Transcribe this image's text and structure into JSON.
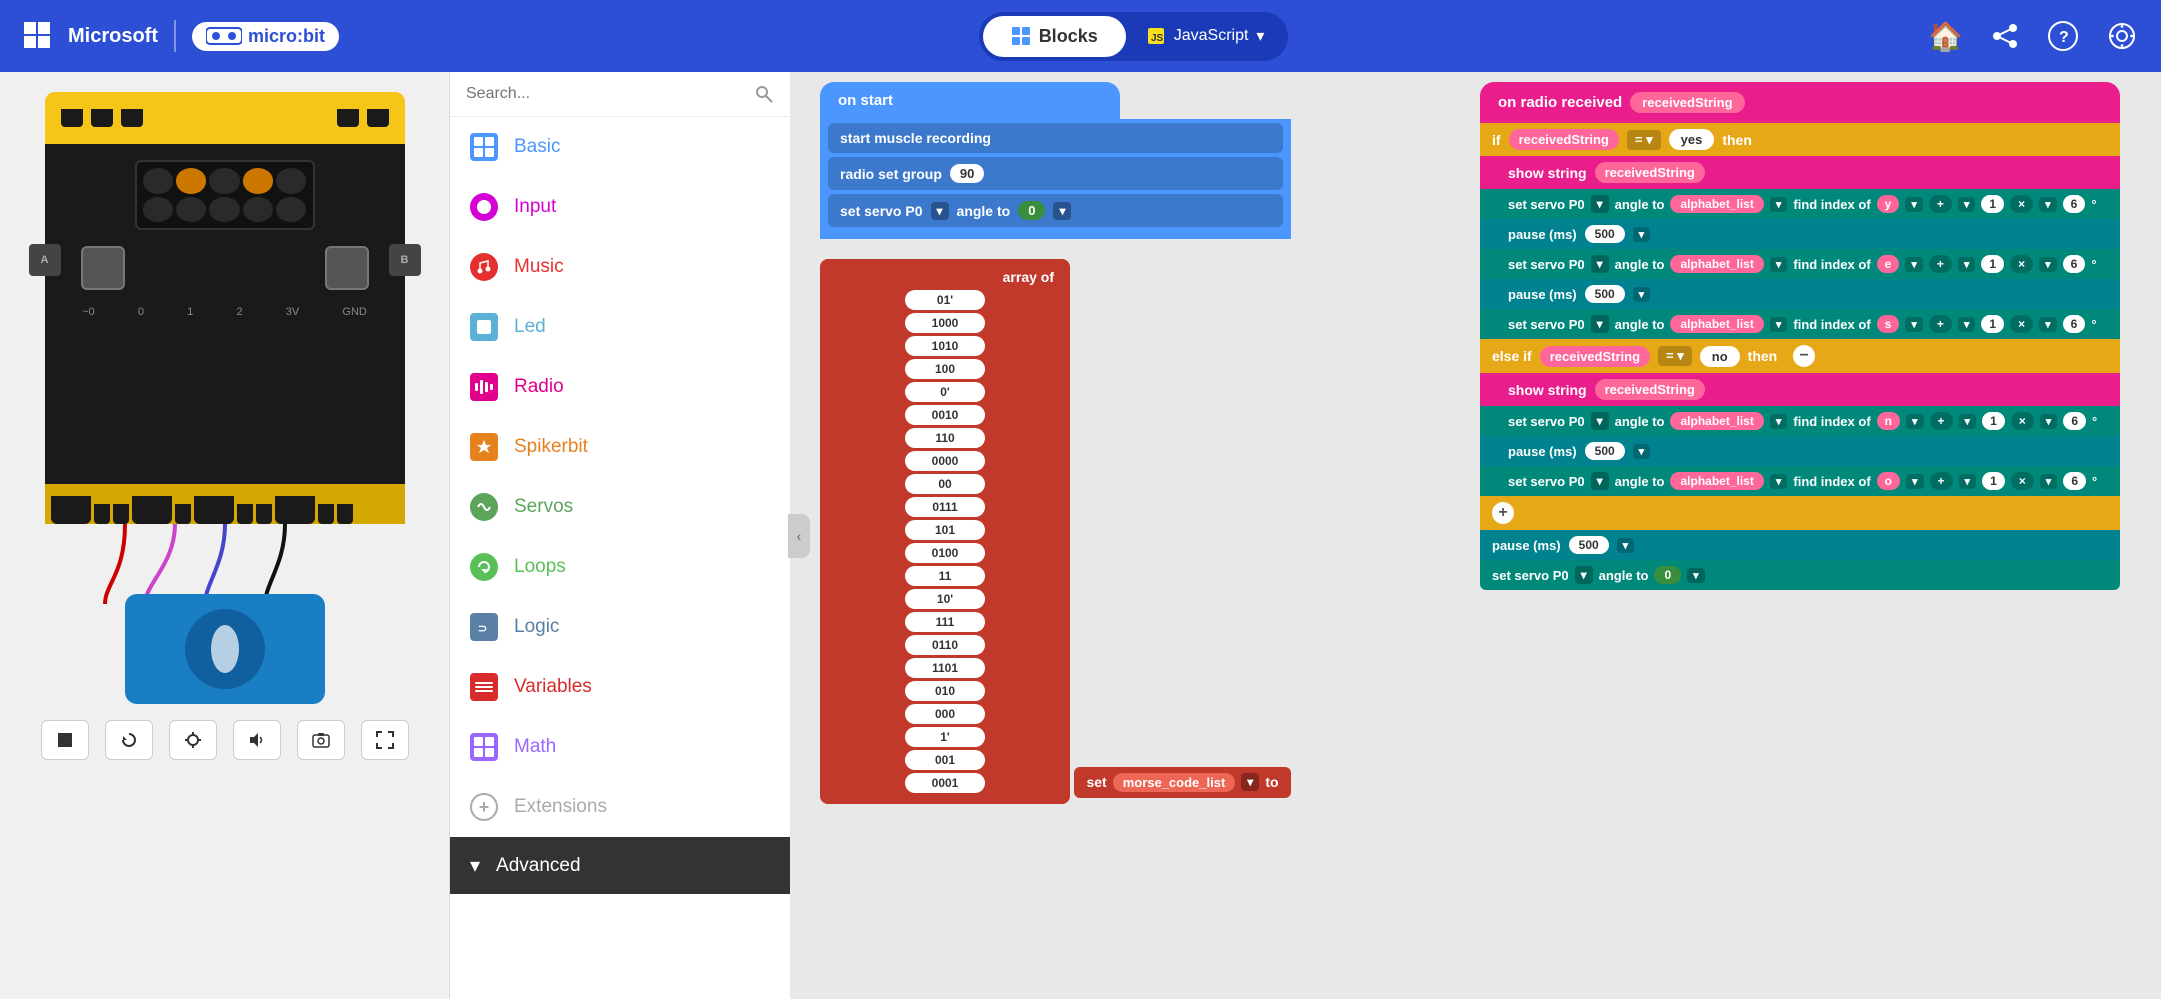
{
  "header": {
    "microsoft_label": "Microsoft",
    "microbit_label": "micro:bit",
    "blocks_label": "Blocks",
    "javascript_label": "JavaScript",
    "home_icon": "🏠",
    "share_icon": "share",
    "help_icon": "?",
    "settings_icon": "⚙"
  },
  "search": {
    "placeholder": "Search..."
  },
  "categories": [
    {
      "id": "basic",
      "label": "Basic",
      "color": "#4c97ff",
      "icon": "grid"
    },
    {
      "id": "input",
      "label": "Input",
      "color": "#d400d4",
      "icon": "circle"
    },
    {
      "id": "music",
      "label": "Music",
      "color": "#e63030",
      "icon": "headphone"
    },
    {
      "id": "led",
      "label": "Led",
      "color": "#5cb1d6",
      "icon": "square"
    },
    {
      "id": "radio",
      "label": "Radio",
      "color": "#e3008c",
      "icon": "bars"
    },
    {
      "id": "spikerbit",
      "label": "Spikerbit",
      "color": "#e6821e",
      "icon": "star"
    },
    {
      "id": "servos",
      "label": "Servos",
      "color": "#5ba55b",
      "icon": "arrows"
    },
    {
      "id": "loops",
      "label": "Loops",
      "color": "#59c059",
      "icon": "loop"
    },
    {
      "id": "logic",
      "label": "Logic",
      "color": "#5b80a5",
      "icon": "logic"
    },
    {
      "id": "variables",
      "label": "Variables",
      "color": "#d82b2b",
      "icon": "lines"
    },
    {
      "id": "math",
      "label": "Math",
      "color": "#9966ff",
      "icon": "grid4"
    },
    {
      "id": "extensions",
      "label": "Extensions",
      "color": "#aaa",
      "icon": "plus"
    },
    {
      "id": "advanced",
      "label": "Advanced",
      "color": "#222",
      "icon": "chevron"
    }
  ],
  "workspace": {
    "on_start": {
      "hat_label": "on start",
      "blocks": [
        {
          "label": "start muscle recording"
        },
        {
          "label": "radio set group",
          "value": "90"
        },
        {
          "label": "set servo P0 ▼ angle to",
          "value": "0"
        }
      ]
    },
    "array_block": {
      "label": "array of",
      "items": [
        "01'",
        "1000",
        "1010",
        "100",
        "0'",
        "0010",
        "110",
        "0000",
        "00",
        "0111",
        "101",
        "0100",
        "11",
        "10'",
        "111",
        "0110",
        "1101",
        "010",
        "000",
        "1'",
        "001",
        "0001"
      ]
    },
    "set_block": {
      "label": "set  morse_code_list ▼ to"
    },
    "radio_received": {
      "hat_label": "on radio received",
      "param_label": "receivedString",
      "if_label": "if",
      "condition_var": "receivedString",
      "condition_op": "=  ▼",
      "condition_val": "yes",
      "then_label": "then",
      "show_string_label": "show string",
      "show_string_var": "receivedString",
      "servo_blocks": [
        {
          "var": "y",
          "op1": "1",
          "op2": "6"
        },
        {
          "var": "e",
          "op1": "1",
          "op2": "6"
        },
        {
          "var": "s",
          "op1": "1",
          "op2": "6"
        }
      ],
      "else_if_label": "else if",
      "else_condition_val": "no",
      "else_then_label": "then",
      "else_show_string_var": "receivedString",
      "else_servo_blocks": [
        {
          "var": "n",
          "op1": "1",
          "op2": "6"
        },
        {
          "var": "o",
          "op1": "1",
          "op2": "6"
        }
      ],
      "pause_label": "pause (ms)",
      "pause_val": "500",
      "final_servo_label": "set servo P0 ▼ angle to",
      "final_servo_val": "0"
    }
  },
  "simulator": {
    "toolbar_buttons": [
      "stop",
      "restart",
      "debug",
      "sound",
      "screenshot",
      "fullscreen"
    ]
  }
}
